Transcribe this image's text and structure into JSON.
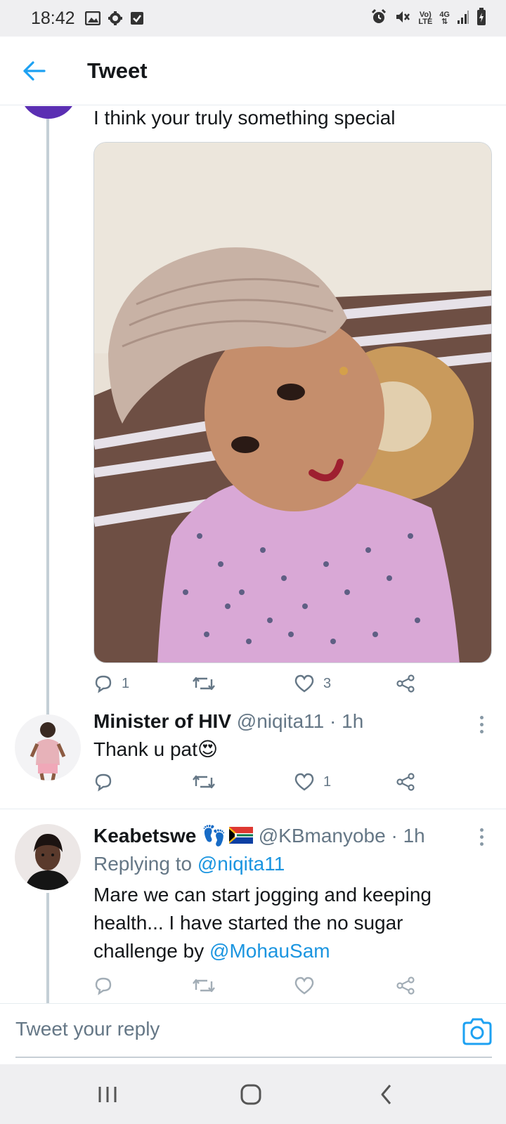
{
  "status_bar": {
    "time": "18:42",
    "network_top": "Vo)",
    "network_bottom": "LTE",
    "data_top": "4G",
    "data_bottom": "⇅",
    "icons": [
      "gallery-icon",
      "settings-gear-icon",
      "check-box-icon",
      "alarm-icon",
      "mute-icon",
      "volte-icon",
      "4g-icon",
      "signal-icon",
      "battery-icon"
    ]
  },
  "header": {
    "title": "Tweet"
  },
  "tweets": [
    {
      "text": "I think your truly something special",
      "actions": {
        "replies": "1",
        "retweets": "",
        "likes": "3"
      }
    },
    {
      "name": "Minister of HIV",
      "handle": "@niqita11",
      "sep": "·",
      "time": "1h",
      "text": "Thank u pat",
      "emoji": "😍",
      "actions": {
        "replies": "",
        "retweets": "",
        "likes": "1"
      }
    },
    {
      "name": "Keabetswe",
      "emoji": "👣",
      "handle": "@KBmanyobe",
      "sep": "·",
      "time": "1h",
      "replying_label": "Replying to",
      "replying_handle": "@niqita11",
      "text": "Mare we can start jogging and keeping health... I have started the no sugar challenge by",
      "mention": "@MohauSam"
    }
  ],
  "reply_bar": {
    "placeholder": "Tweet your reply"
  },
  "colors": {
    "accent": "#1da1f2",
    "text_primary": "#14171a",
    "text_secondary": "#657786",
    "avatar_purple": "#5b2fb3",
    "status_bar_bg": "#efeff1"
  }
}
